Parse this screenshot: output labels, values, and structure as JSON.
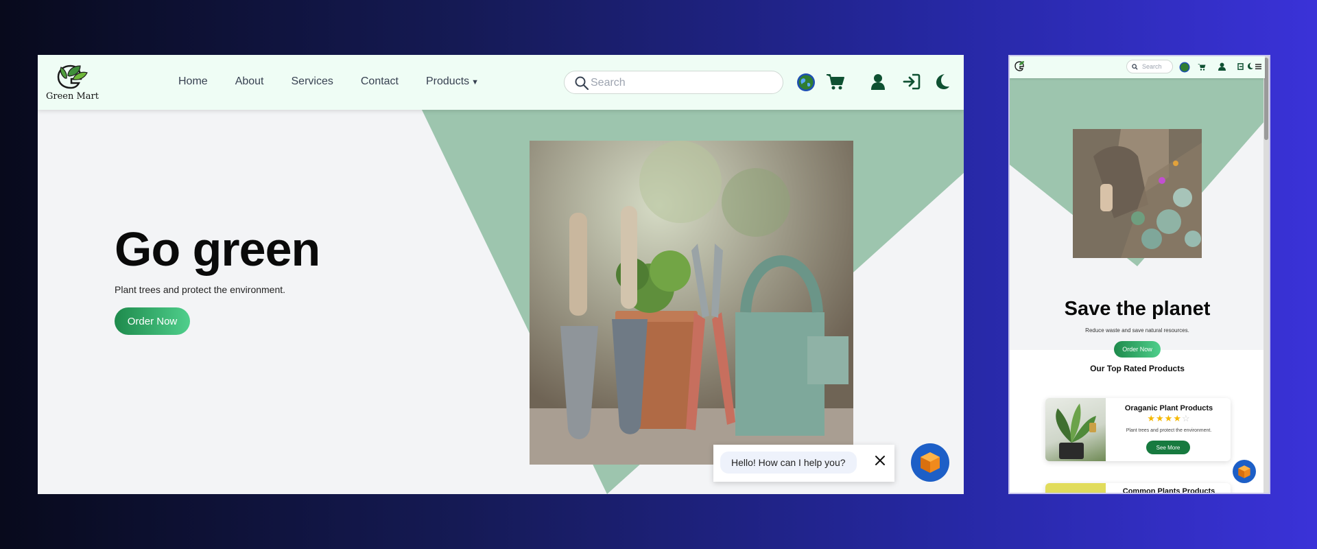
{
  "brand": {
    "name": "Green Mart"
  },
  "nav": {
    "links": [
      "Home",
      "About",
      "Services",
      "Contact"
    ],
    "products_label": "Products",
    "search_placeholder": "Search"
  },
  "hero": {
    "title": "Go green",
    "subtitle": "Plant trees and protect the environment.",
    "button": "Order Now"
  },
  "chat": {
    "message": "Hello! How can I help you?"
  },
  "mobile": {
    "search_placeholder": "Search",
    "hero_title": "Save the planet",
    "hero_subtitle": "Reduce waste and save natural resources.",
    "hero_button": "Order Now",
    "section_title": "Our Top Rated Products",
    "products": [
      {
        "title": "Oraganic Plant Products",
        "rating": 4,
        "max_rating": 5,
        "description": "Plant trees and protect the environment.",
        "button": "See More"
      },
      {
        "title": "Common Plants Products"
      }
    ]
  },
  "colors": {
    "brand_green": "#177a3f",
    "accent_green": "#4fcf8c",
    "nav_bg": "#effdf5",
    "triangle": "#9dc5ae",
    "chat_blue": "#1d5fc7"
  },
  "icons": [
    "search-icon",
    "globe-icon",
    "cart-icon",
    "user-icon",
    "login-icon",
    "moon-icon",
    "close-icon",
    "chat-bot-icon",
    "menu-icon",
    "caret-down-icon",
    "star-icon"
  ]
}
